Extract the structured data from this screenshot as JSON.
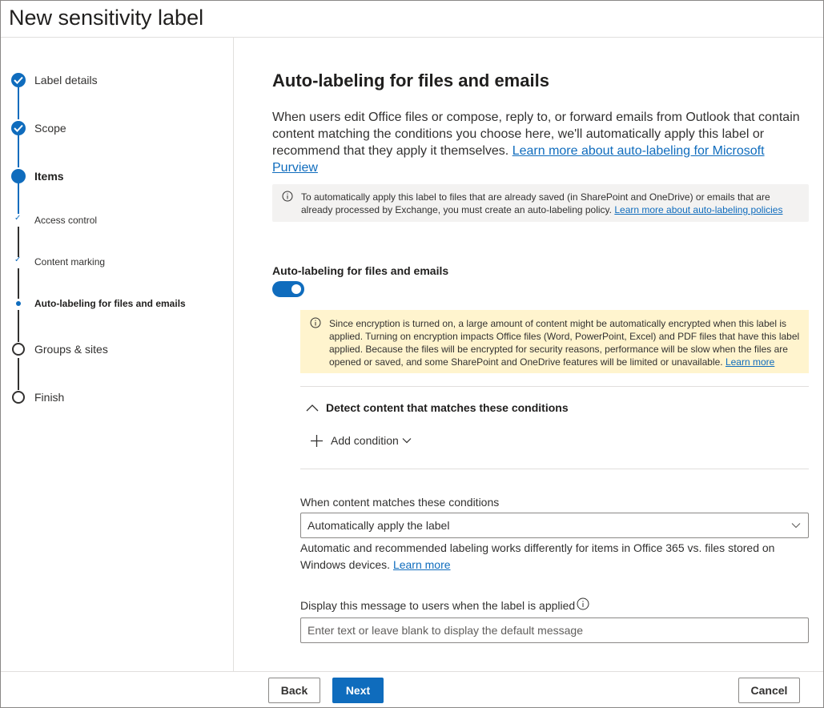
{
  "header": {
    "title": "New sensitivity label"
  },
  "sidebar": {
    "steps": [
      {
        "label": "Label details",
        "state": "done"
      },
      {
        "label": "Scope",
        "state": "done"
      },
      {
        "label": "Items",
        "state": "current"
      },
      {
        "label": "Access control",
        "state": "sub-done"
      },
      {
        "label": "Content marking",
        "state": "sub-done"
      },
      {
        "label": "Auto-labeling for files and emails",
        "state": "sub-current"
      },
      {
        "label": "Groups & sites",
        "state": "pending"
      },
      {
        "label": "Finish",
        "state": "pending"
      }
    ]
  },
  "main": {
    "title": "Auto-labeling for files and emails",
    "description": "When users edit Office files or compose, reply to, or forward emails from Outlook that contain content matching the conditions you choose here, we'll automatically apply this label or recommend that they apply it themselves. ",
    "description_link": "Learn more about auto-labeling for Microsoft Purview",
    "info_text": "To automatically apply this label to files that are already saved (in SharePoint and OneDrive) or emails that are already processed by Exchange, you must create an auto-labeling policy. ",
    "info_link": "Learn more about auto-labeling policies",
    "toggle_label": "Auto-labeling for files and emails",
    "toggle_on": true,
    "warning_text": "Since encryption is turned on, a large amount of content might be automatically encrypted when this label is applied. Turning on encryption impacts Office files (Word, PowerPoint, Excel) and PDF files that have this label applied. Because the files will be encrypted for security reasons, performance will be slow when the files are opened or saved, and some SharePoint and OneDrive features will be limited or unavailable. ",
    "warning_link": "Learn more",
    "section_title": "Detect content that matches these conditions",
    "add_condition": "Add condition",
    "when_label": "When content matches these conditions",
    "when_value": "Automatically apply the label",
    "help_text": "Automatic and recommended labeling works differently for items in Office 365 vs. files stored on Windows devices. ",
    "help_link": "Learn more",
    "message_label": "Display this message to users when the label is applied",
    "message_placeholder": "Enter text or leave blank to display the default message"
  },
  "footer": {
    "back": "Back",
    "next": "Next",
    "cancel": "Cancel"
  },
  "colors": {
    "accent": "#0f6cbd",
    "warning_bg": "#fff4ce",
    "info_bg": "#f3f2f1"
  }
}
